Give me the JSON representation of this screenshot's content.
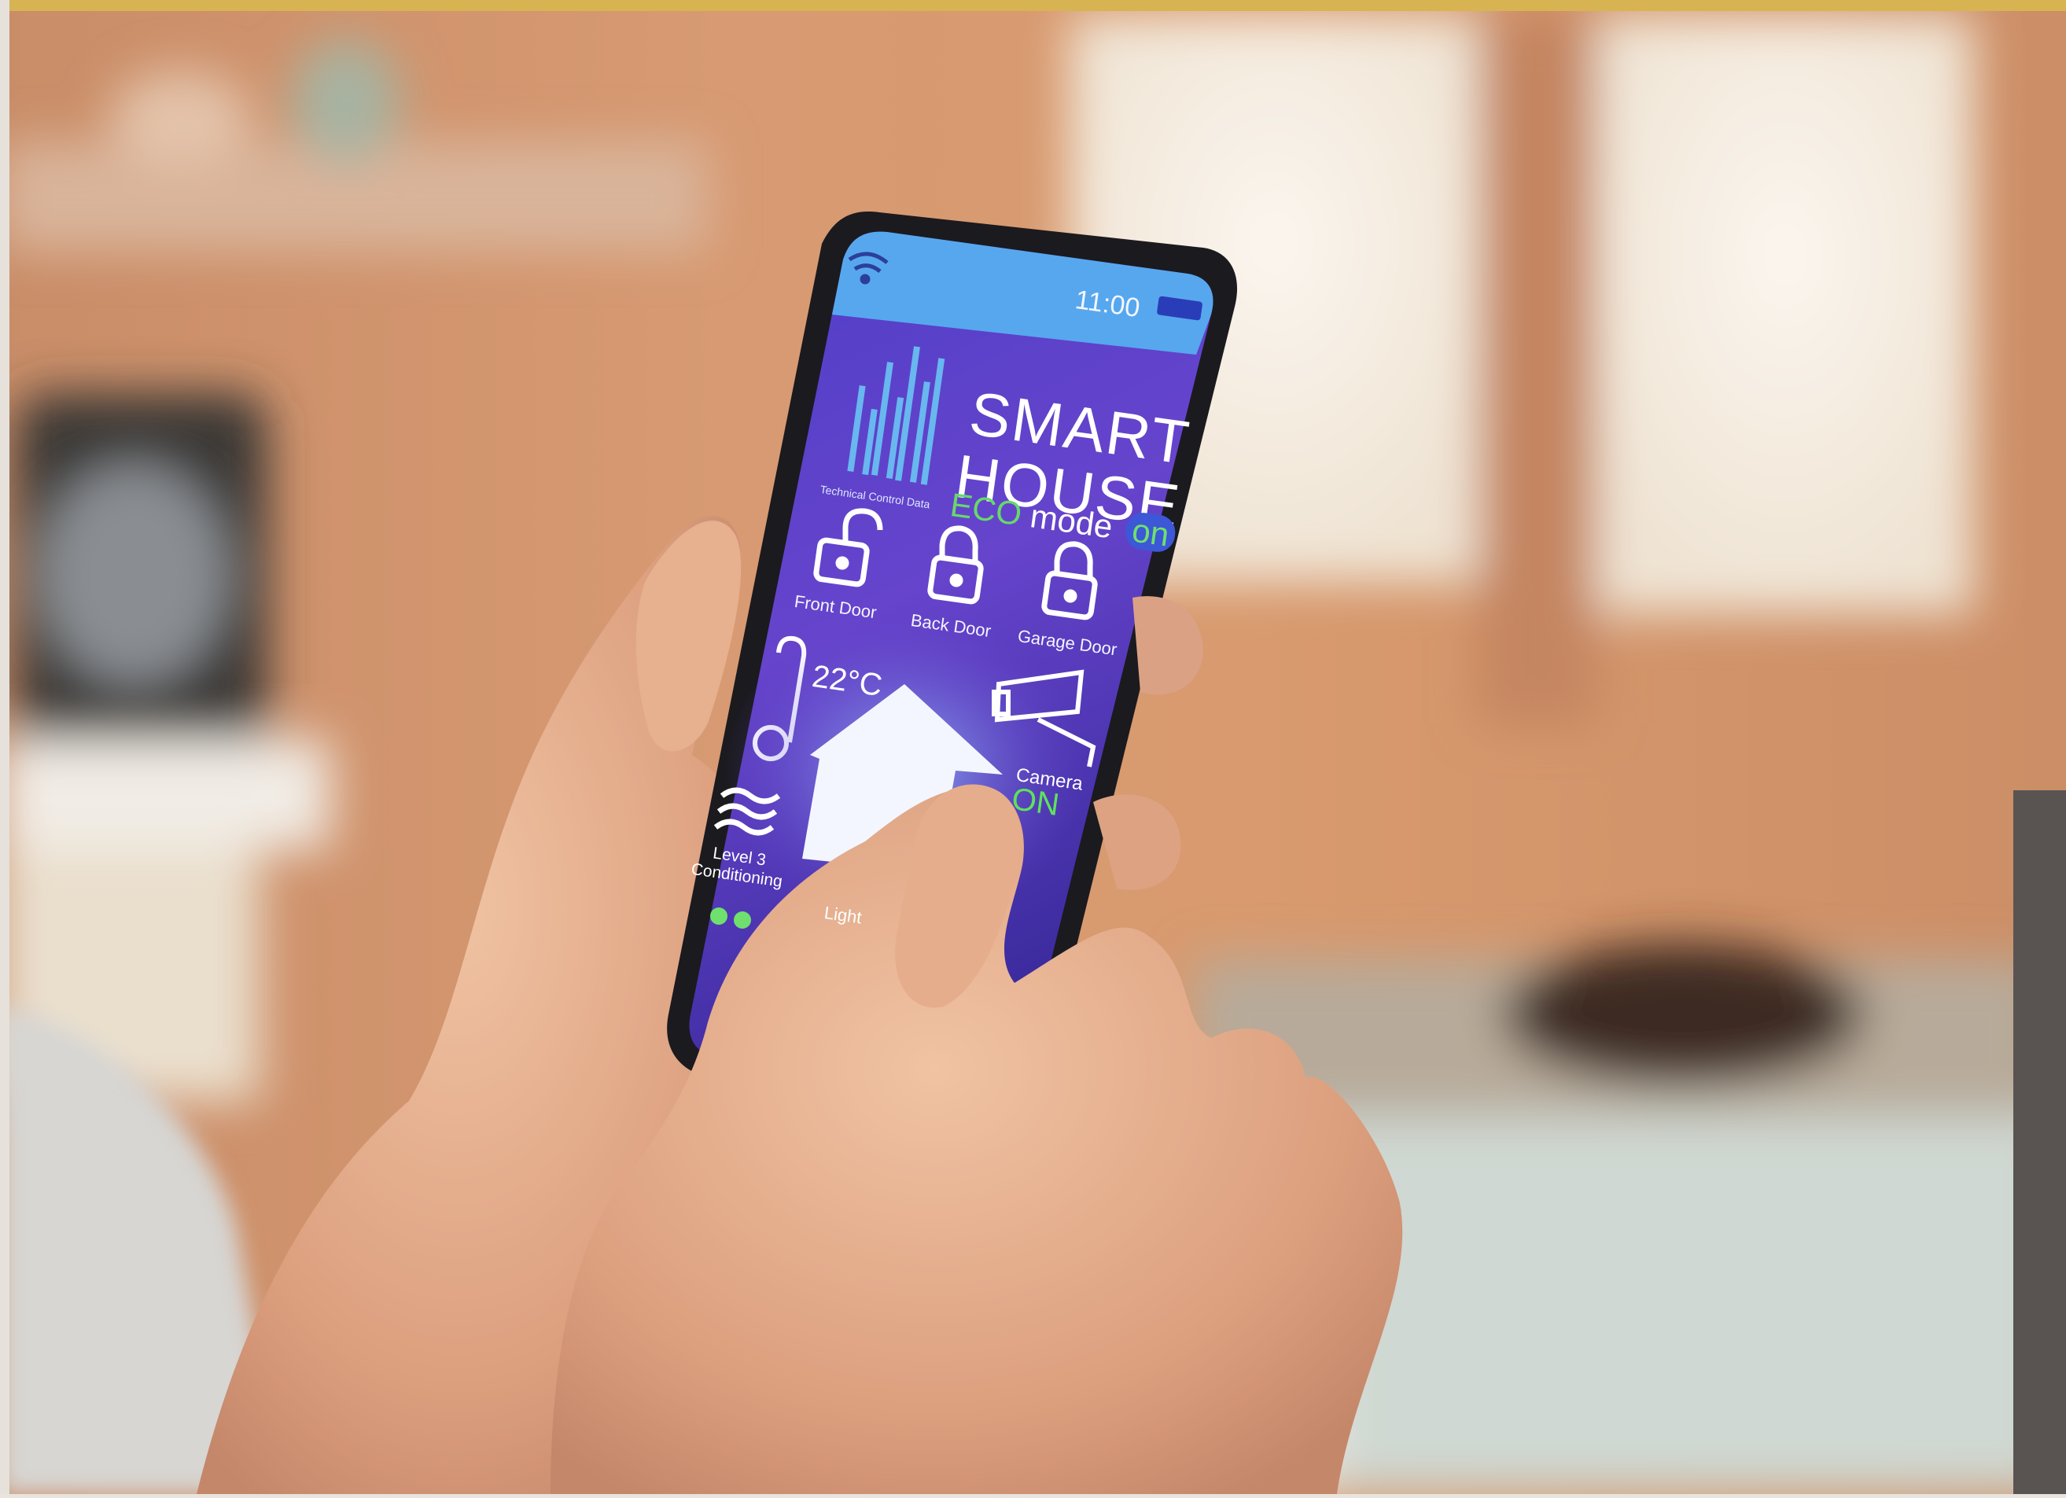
{
  "status_bar": {
    "time": "11:00"
  },
  "app": {
    "title_line1": "SMART",
    "title_line2": "HOUSE",
    "chart_caption": "Technical Control Data",
    "eco_word": "ECO",
    "mode_word": "mode",
    "eco_status": "on"
  },
  "locks": [
    {
      "label": "Front Door",
      "state": "unlocked"
    },
    {
      "label": "Back Door",
      "state": "locked"
    },
    {
      "label": "Garage Door",
      "state": "locked"
    }
  ],
  "temperature": "22°C",
  "camera": {
    "label": "Camera",
    "status": "ON"
  },
  "conditioning": {
    "line1": "Level 3",
    "line2": "Conditioning"
  },
  "light": {
    "label": "Light"
  },
  "colors": {
    "accent_gold": "#d8b352",
    "screen_purple": "#5b3fc4",
    "status_blue": "#57a7ee",
    "eco_green": "#67d96a",
    "side_panel": "#595452"
  },
  "icons": [
    "wifi-icon",
    "battery-icon",
    "bar-chart-icon",
    "unlocked-padlock-icon",
    "padlock-icon",
    "thermometer-icon",
    "house-icon",
    "security-camera-icon",
    "wind-waves-icon",
    "light-bulb-icon"
  ]
}
